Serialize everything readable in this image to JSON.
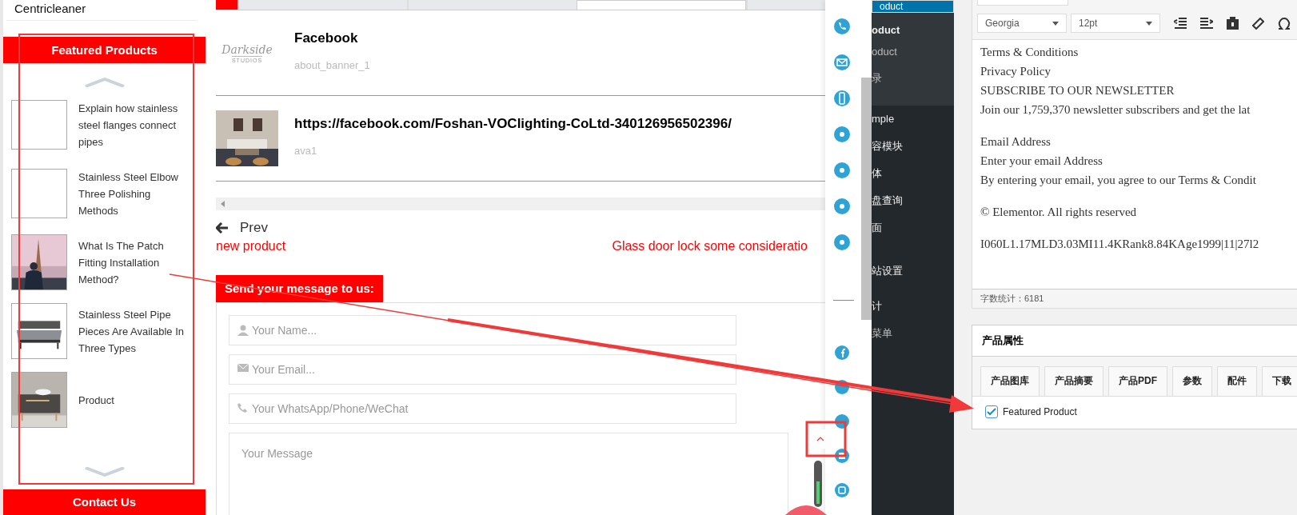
{
  "left": {
    "site_title": "Centricleaner",
    "featured_heading": "Featured Products",
    "contact_heading": "Contact Us",
    "products": [
      {
        "title": "Explain how stainless steel flanges connect pipes",
        "kind": "empty"
      },
      {
        "title": "Stainless Steel Elbow Three Polishing Methods",
        "kind": "empty"
      },
      {
        "title": "What Is The Patch Fitting Installation Method?",
        "kind": "tower"
      },
      {
        "title": "Stainless Steel Pipe Pieces Are Available In Three Types",
        "kind": "bed"
      },
      {
        "title": "Product",
        "kind": "cabinet"
      }
    ]
  },
  "content": {
    "tabs": [
      {
        "selected": false
      },
      {
        "selected": false
      },
      {
        "selected": true
      },
      {
        "selected": false
      }
    ],
    "rows": [
      {
        "title": "Facebook",
        "subtitle": "about_banner_1",
        "kind": "logo",
        "logo_text": "Darkside",
        "logo_sub": "STUDIOS"
      },
      {
        "title": "https://facebook.com/Foshan-VOClighting-CoLtd-340126956502396/",
        "subtitle": "ava1",
        "kind": "room"
      }
    ],
    "prev": "Prev",
    "prev_post": "new product",
    "next_post": "Glass door lock some consideratio",
    "form": {
      "heading": "Send your message to us:",
      "fields": [
        {
          "kind": "name",
          "placeholder": "Your Name..."
        },
        {
          "kind": "email",
          "placeholder": "Your Email..."
        },
        {
          "kind": "phone",
          "placeholder": "Your WhatsApp/Phone/WeChat"
        },
        {
          "kind": "message",
          "placeholder": "Your Message"
        }
      ]
    }
  },
  "admin_menu": [
    {
      "label": "oduct",
      "selected": true
    },
    {
      "label": "oduct",
      "selected": false
    },
    {
      "label": "oduct",
      "selected": false
    },
    {
      "label": "录",
      "selected": false
    },
    {
      "label": "mple",
      "selected": false
    },
    {
      "label": "容模块",
      "selected": false
    },
    {
      "label": "体",
      "selected": false
    },
    {
      "label": "盘查询",
      "selected": false
    },
    {
      "label": "面",
      "selected": false
    },
    {
      "label": "站设置",
      "selected": false
    },
    {
      "label": "计",
      "selected": false
    },
    {
      "label": "菜单",
      "selected": false
    }
  ],
  "editor": {
    "font": "Georgia",
    "size": "12pt",
    "paragraphs": [
      [
        "Terms & Conditions",
        "Privacy Policy",
        "SUBSCRIBE TO OUR NEWSLETTER",
        "Join our 1,759,370 newsletter subscribers and get the lat"
      ],
      [
        "Email Address",
        "Enter your email Address",
        "By entering your email, you agree to our Terms & Condit"
      ],
      [
        "© Elementor. All rights reserved"
      ],
      [
        "I060L1.17MLD3.03MI11.4KRank8.84KAge1999|11|27l2"
      ]
    ],
    "word_count": "字数统计：6181"
  },
  "attributes": {
    "title": "产品属性",
    "tabs": [
      "产品图库",
      "产品摘要",
      "产品PDF",
      "参数",
      "配件",
      "下载"
    ],
    "checkbox": {
      "label": "Featured Product",
      "checked": true
    }
  }
}
